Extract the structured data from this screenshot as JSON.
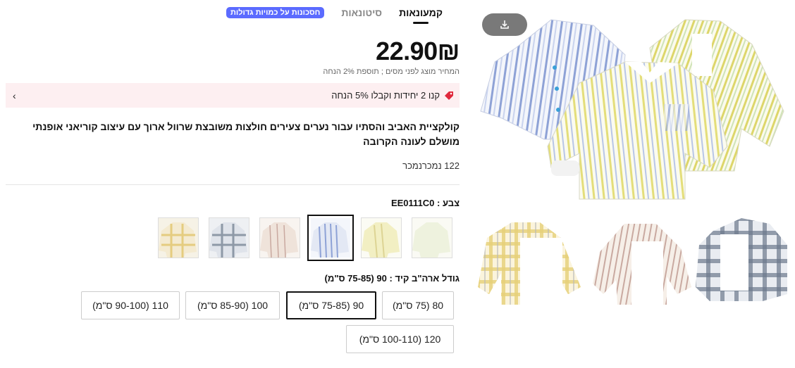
{
  "tabs": [
    {
      "label": "קמעונאות"
    },
    {
      "label": "סיטונאות"
    }
  ],
  "bulk_badge": "חסכונות על כמויות גדולות",
  "price": "22.90₪",
  "price_note": "המחיר מוצג לפני מסים ; תוספת 2% הנחה",
  "promo": {
    "text": "קנו 2 יחידות וקבלו 5% הנחה",
    "icon": "tag-icon"
  },
  "product_title": "קולקציית האביב והסתיו עבור נערים צעירים חולצות משובצת שרוול ארוך עם עיצוב קוריאני אופנתי מושלם לעונה הקרובה",
  "sold": "122 נמכרנמכר",
  "color": {
    "label": "צבע : EE0111C0",
    "selected_index": 3
  },
  "size": {
    "label": "גודל ארה\"ב קיד : 90 (75-85 ס\"מ)",
    "options": [
      "80 (75 ס\"מ)",
      "90 (75-85 ס\"מ)",
      "100 (85-90 ס\"מ)",
      "110 (90-100 ס\"מ)",
      "120 (100-110 ס\"מ)"
    ],
    "selected_index": 1
  },
  "colors": {
    "accent": "#5b6bff",
    "promo_bg": "#fdeff1",
    "promo_icon": "#e0283c"
  }
}
